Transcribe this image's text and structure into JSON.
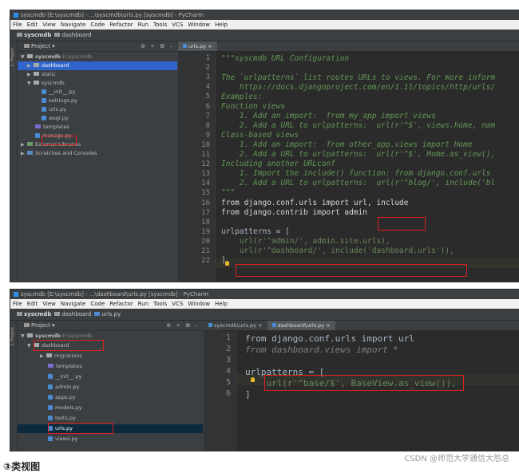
{
  "screenshot1": {
    "title": "syscmdb [E:\\syscmdb] - ...\\syscmdb\\urls.py [syscmdb] - PyCharm",
    "menu": [
      "File",
      "Edit",
      "View",
      "Navigate",
      "Code",
      "Refactor",
      "Run",
      "Tools",
      "VCS",
      "Window",
      "Help"
    ],
    "breadcrumb": [
      "syscmdb",
      "dashboard"
    ],
    "side_tab": "1: Project",
    "panel_title": "Project",
    "panel_tools": "⊕ ÷ ✿ –",
    "tree": [
      {
        "label": "syscmdb",
        "extra": "E:\\syscmdb",
        "kind": "folder",
        "open": true
      },
      {
        "label": "dashboard",
        "kind": "folder",
        "open": false,
        "selected": true
      },
      {
        "label": "static",
        "kind": "folder",
        "open": false
      },
      {
        "label": "syscmdb",
        "kind": "folder",
        "open": true
      },
      {
        "label": "__init__.py",
        "kind": "py"
      },
      {
        "label": "settings.py",
        "kind": "py"
      },
      {
        "label": "urls.py",
        "kind": "py"
      },
      {
        "label": "wsgi.py",
        "kind": "py"
      },
      {
        "label": "templates",
        "kind": "folder"
      },
      {
        "label": "manage.py",
        "kind": "py"
      },
      {
        "label": "External Libraries",
        "kind": "lib",
        "open": false
      },
      {
        "label": "Scratches and Consoles",
        "kind": "lib",
        "open": false
      }
    ],
    "tab": "urls.py",
    "line_numbers": [
      "1",
      "2",
      "3",
      "4",
      "5",
      "6",
      "7",
      "8",
      "9",
      "10",
      "11",
      "12",
      "13",
      "14",
      "15",
      "16",
      "17",
      "18",
      "19",
      "20",
      "21",
      "22"
    ],
    "code": [
      "\"\"\"syscmdb URL Configuration",
      "",
      "The `urlpatterns` list routes URLs to views. For more inform",
      "    https://docs.djangoproject.com/en/1.11/topics/http/urls/",
      "Examples:",
      "Function views",
      "    1. Add an import:  from my_app import views",
      "    2. Add a URL to urlpatterns:  url(r'^$', views.home, nam",
      "Class-based views",
      "    1. Add an import:  from other_app.views import Home",
      "    2. Add a URL to urlpatterns:  url(r'^$', Home.as_view(),",
      "Including another URLconf",
      "    1. Import the include() function: from django.conf.urls",
      "    2. Add a URL to urlpatterns:  url(r'^blog/', include('bl",
      "\"\"\"",
      "from django.conf.urls import url, include",
      "from django.contrib import admin",
      "",
      "urlpatterns = [",
      "    url(r'^admin/', admin.site.urls),",
      "    url(r'^dashboard/', include('dashboard.urls')),",
      "]"
    ]
  },
  "screenshot2": {
    "title": "syscmdb [E:\\syscmdb] - ...\\dashboard\\urls.py [syscmdb] - PyCharm",
    "menu": [
      "File",
      "Edit",
      "View",
      "Navigate",
      "Code",
      "Refactor",
      "Run",
      "Tools",
      "VCS",
      "Window",
      "Help"
    ],
    "breadcrumb": [
      "syscmdb",
      "dashboard",
      "urls.py"
    ],
    "side_tab": "1: Project",
    "panel_title": "Project",
    "panel_tools": "⊕ ÷ ✿ –",
    "tree": [
      {
        "label": "syscmdb",
        "extra": "E:\\syscmdb",
        "kind": "folder",
        "open": true
      },
      {
        "label": "dashboard",
        "kind": "folder",
        "open": true
      },
      {
        "label": "migrations",
        "kind": "folder",
        "open": false
      },
      {
        "label": "templates",
        "kind": "folder"
      },
      {
        "label": "__init__.py",
        "kind": "py"
      },
      {
        "label": "admin.py",
        "kind": "py"
      },
      {
        "label": "apps.py",
        "kind": "py"
      },
      {
        "label": "models.py",
        "kind": "py"
      },
      {
        "label": "tests.py",
        "kind": "py"
      },
      {
        "label": "urls.py",
        "kind": "py",
        "selected": true
      },
      {
        "label": "views.py",
        "kind": "py"
      }
    ],
    "tabs": [
      "syscmdb\\urls.py",
      "dashboard\\urls.py"
    ],
    "line_numbers": [
      "1",
      "2",
      "3",
      "4",
      "5",
      "6"
    ],
    "code": [
      "from django.conf.urls import url",
      "from dashboard.views import *",
      "",
      "urlpatterns = [",
      "    url(r'^base/$', BaseView.as_view()),",
      "]"
    ]
  },
  "caption": "③类视图",
  "watermark": "CSDN @师范大学通信大怨总"
}
